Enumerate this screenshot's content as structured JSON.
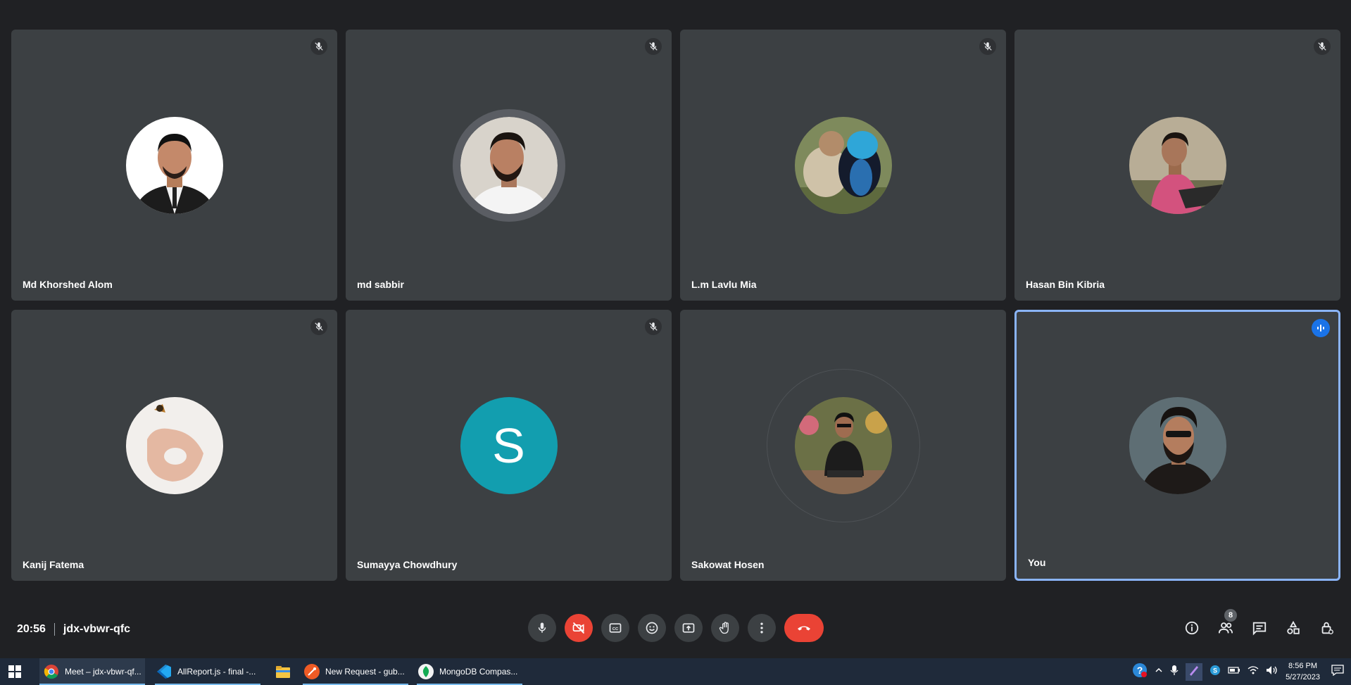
{
  "participants": [
    {
      "name": "Md Khorshed Alom",
      "muted": true,
      "avatar": "photo-man-suit"
    },
    {
      "name": "md sabbir",
      "muted": true,
      "avatar": "photo-man-white-shirt"
    },
    {
      "name": "L.m Lavlu Mia",
      "muted": true,
      "avatar": "photo-birds"
    },
    {
      "name": "Hasan Bin Kibria",
      "muted": true,
      "avatar": "photo-man-pink-shirt"
    },
    {
      "name": "Kanij Fatema",
      "muted": true,
      "avatar": "photo-hand-butterfly"
    },
    {
      "name": "Sumayya Chowdhury",
      "muted": true,
      "avatar_letter": "S",
      "avatar_color": "#129eaf"
    },
    {
      "name": "Sakowat Hosen",
      "muted": false,
      "avatar": "photo-man-sitting"
    },
    {
      "name": "You",
      "muted": false,
      "speaking": true,
      "avatar": "photo-man-sunglasses"
    }
  ],
  "meeting": {
    "time": "20:56",
    "code": "jdx-vbwr-qfc",
    "participant_count": "8"
  },
  "controls": {
    "icons": [
      "mic-icon",
      "camera-off-icon",
      "captions-icon",
      "emoji-icon",
      "present-icon",
      "raise-hand-icon",
      "more-options-icon",
      "hangup-icon"
    ],
    "right_icons": [
      "info-icon",
      "people-icon",
      "chat-icon",
      "activities-icon",
      "host-controls-icon"
    ]
  },
  "taskbar": {
    "items": [
      {
        "label": "Meet – jdx-vbwr-qf...",
        "icon": "chrome-icon"
      },
      {
        "label": "AllReport.js - final -...",
        "icon": "vscode-icon"
      },
      {
        "label": "",
        "icon": "file-explorer-icon"
      },
      {
        "label": "New Request - gub...",
        "icon": "postman-icon"
      },
      {
        "label": "MongoDB Compas...",
        "icon": "mongodb-icon"
      }
    ],
    "time": "8:56 PM",
    "date": "5/27/2023"
  },
  "colors": {
    "background": "#202124",
    "tile": "#3c4043",
    "active_border": "#8ab4f8",
    "red": "#ea4335",
    "speaking_blue": "#1a73e8"
  }
}
